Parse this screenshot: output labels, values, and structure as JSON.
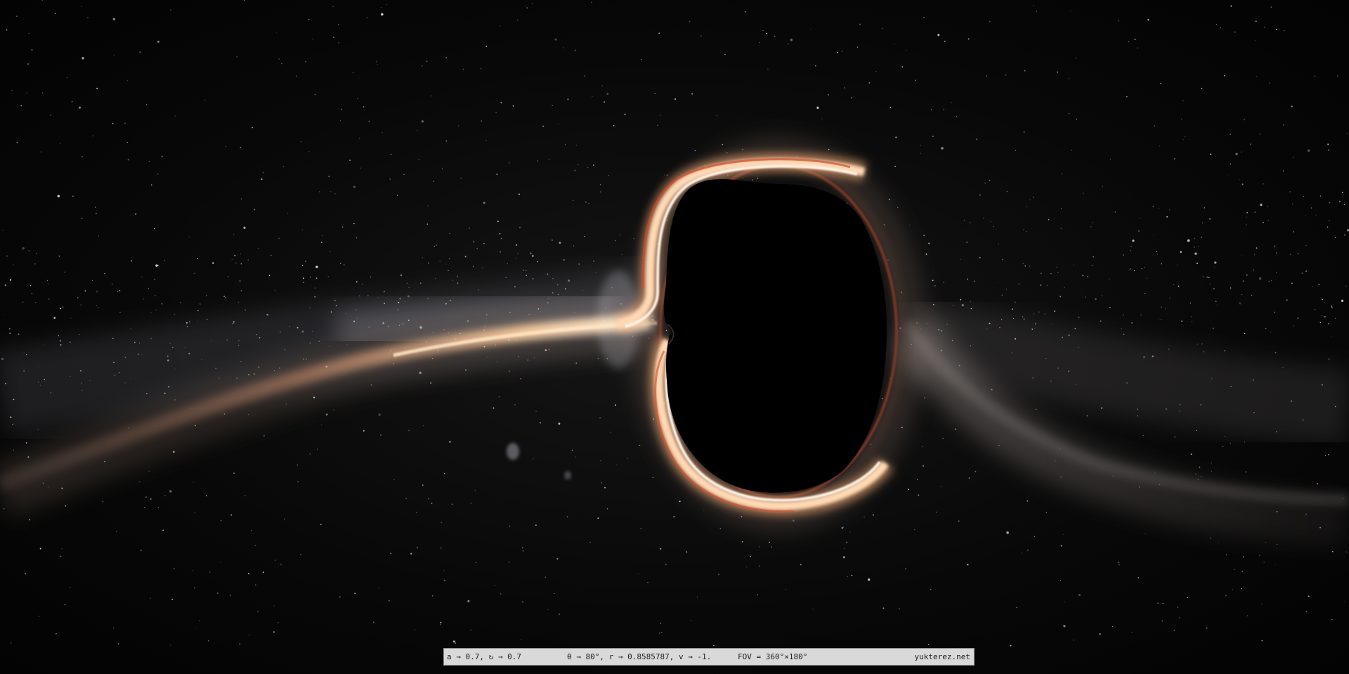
{
  "scene": {
    "subject": "black-hole-panorama",
    "colors": {
      "space": "#050505",
      "disk_hot": "#fff4dc",
      "disk_warm": "#ffb06a",
      "disk_red": "#d9502a",
      "milky_way": "#cfcfd8"
    }
  },
  "caption": {
    "params_text": "a → 0.7, ↻ → 0.7",
    "orbit_text": "θ → 80°, r → 0.8585787, v → -1.",
    "fov_text": "FOV = 360°×180°",
    "site_text": "yukterez.net"
  }
}
